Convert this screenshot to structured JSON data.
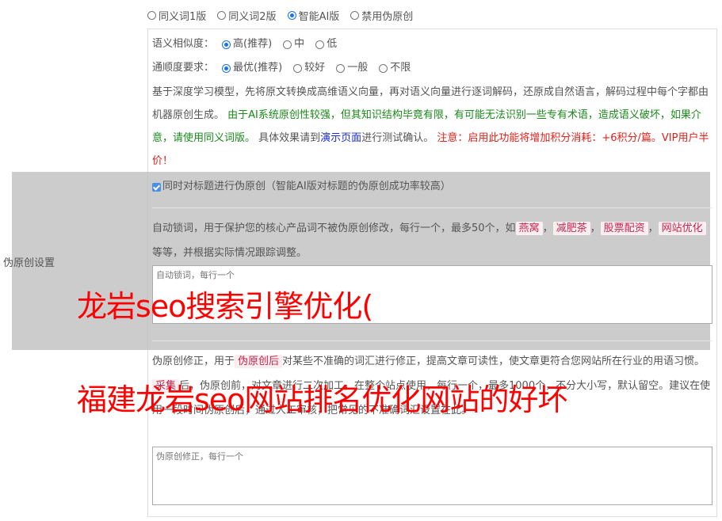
{
  "version_options": [
    {
      "label": "同义词1版",
      "selected": false
    },
    {
      "label": "同义词2版",
      "selected": false
    },
    {
      "label": "智能AI版",
      "selected": true
    },
    {
      "label": "禁用伪原创",
      "selected": false
    }
  ],
  "similarity": {
    "label": "语义相似度：",
    "options": [
      {
        "label": "高(推荐)",
        "selected": true
      },
      {
        "label": "中",
        "selected": false
      },
      {
        "label": "低",
        "selected": false
      }
    ]
  },
  "fluency": {
    "label": "通顺度要求：",
    "options": [
      {
        "label": "最优(推荐)",
        "selected": true
      },
      {
        "label": "较好",
        "selected": false
      },
      {
        "label": "一般",
        "selected": false
      },
      {
        "label": "不限",
        "selected": false
      }
    ]
  },
  "description": {
    "p1": "基于深度学习模型，先将原文转换成高维语义向量，再对语义向量进行逐词解码，还原成自然语言，解码过程中每个字都由机器原创生成。",
    "green": "由于AI系统原创性较强，但其知识结构毕竟有限，有可能无法识别一些专有术语，造成语义破坏，如果介意，请使用同义词版。",
    "p2": "具体效果请到",
    "link": "演示页面",
    "p3": "进行测试确认。",
    "red": "注意：启用此功能将增加积分消耗：+6积分/篇。VIP用户半价！"
  },
  "title_checkbox": {
    "label": "同时对标题进行伪原创（智能AI版对标题的伪原创成功率较高）",
    "checked": true
  },
  "settings_label": "伪原创设置",
  "lock_words": {
    "p1": "自动锁词，用于保护您的核心产品词不被伪原创修改，每行一个，最多50个，如",
    "tags": [
      "燕窝",
      "减肥茶",
      "股票配资",
      "网站优化"
    ],
    "p2": "等等，并根据实际情况跟踪调整。",
    "placeholder": "自动锁词，每行一个"
  },
  "correction": {
    "p1": "伪原创修正，用于",
    "tag1": "伪原创后",
    "p2": "对某些不准确的词汇进行修正，提高文章可读性，使文章更符合您网站所在行业的用语习惯。",
    "tag2": "采集",
    "p3": "后，伪原创前，对文章进行二次加工，在整个站点使用，每行一个，最多1000个，不分大小写，默认留空。建议在使用一段时间伪原创后，通过人工审核，把常见的不准确词汇设置在此。",
    "placeholder": "伪原创修正，每行一个"
  },
  "watermark": {
    "line1": "龙岩seo搜索引擎优化(",
    "line2": "福建龙岩seo网站排名优化网站的好坏"
  }
}
